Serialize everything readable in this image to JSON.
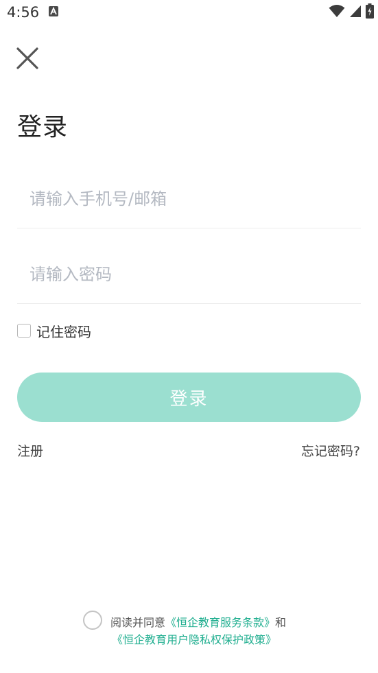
{
  "status_bar": {
    "time": "4:56"
  },
  "header": {
    "close_icon": "close-icon",
    "title": "登录"
  },
  "form": {
    "phone_placeholder": "请输入手机号/邮箱",
    "phone_value": "",
    "password_placeholder": "请输入密码",
    "password_value": "",
    "remember_label": "记住密码",
    "remember_checked": false,
    "login_label": "登录"
  },
  "links": {
    "register": "注册",
    "forgot": "忘记密码?"
  },
  "agreement": {
    "prefix": "阅读并同意",
    "terms_link": "《恒企教育服务条款》",
    "conjunction": "和",
    "privacy_link": "《恒企教育用户隐私权保护政策》",
    "checked": false
  },
  "colors": {
    "accent": "#9bdfd0",
    "link": "#1fae8f",
    "placeholder": "#b4b9c2"
  }
}
